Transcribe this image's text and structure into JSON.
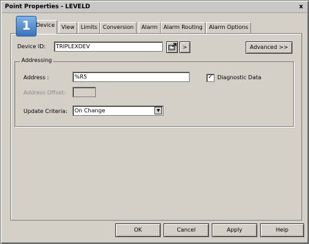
{
  "window": {
    "title": "Point Properties - LEVELD",
    "close_glyph": "x"
  },
  "badge": "1",
  "tabs": [
    "Device",
    "View",
    "Limits",
    "Conversion",
    "Alarm",
    "Alarm Routing",
    "Alarm Options"
  ],
  "device": {
    "label": "Device ID:",
    "value": "TRIPLEXDEV",
    "browse_icon": "device-browse-icon",
    "arrow_label": ">",
    "advanced_label": "Advanced >>"
  },
  "addressing": {
    "group_title": "Addressing",
    "address_label": "Address :",
    "address_value": "%R5",
    "offset_label": "Address Offset:",
    "offset_value": "",
    "diagnostic_label": "Diagnostic Data",
    "diagnostic_checked_glyph": "✓",
    "criteria_label": "Update Criteria:",
    "criteria_value": "On Change",
    "dropdown_glyph": "▼"
  },
  "footer": {
    "ok": "OK",
    "cancel": "Cancel",
    "apply": "Apply",
    "help": "Help"
  }
}
